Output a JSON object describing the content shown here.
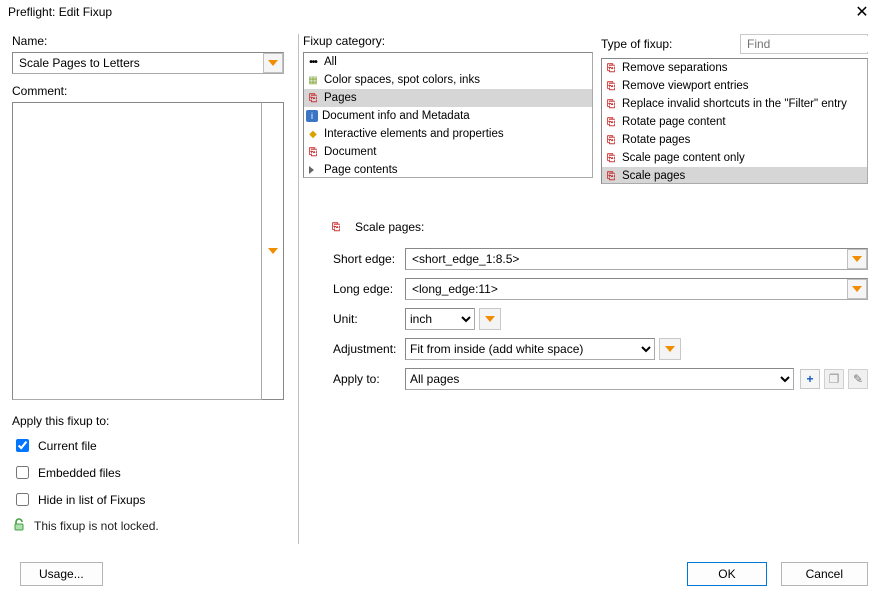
{
  "title": "Preflight: Edit Fixup",
  "left": {
    "name_label": "Name:",
    "name_value": "Scale Pages to Letters",
    "comment_label": "Comment:",
    "apply_label": "Apply this fixup to:",
    "current_file": "Current file",
    "embedded_files": "Embedded files",
    "hide_in_list": "Hide in list of Fixups",
    "lock_text": "This fixup is not locked.",
    "usage_btn": "Usage..."
  },
  "cat": {
    "label": "Fixup category:",
    "items": [
      "All",
      "Color spaces, spot colors, inks",
      "Pages",
      "Document info and Metadata",
      "Interactive elements and properties",
      "Document",
      "Page contents"
    ]
  },
  "typ": {
    "label": "Type of fixup:",
    "find_placeholder": "Find",
    "items": [
      "Remove separations",
      "Remove viewport entries",
      "Replace invalid shortcuts in the \"Filter\" entry",
      "Rotate page content",
      "Rotate pages",
      "Scale page content only",
      "Scale pages"
    ]
  },
  "detail": {
    "header": "Scale pages:",
    "short_label": "Short edge:",
    "short_value": "<short_edge_1:8.5>",
    "long_label": "Long edge:",
    "long_value": "<long_edge:11>",
    "unit_label": "Unit:",
    "unit_value": "inch",
    "adj_label": "Adjustment:",
    "adj_value": "Fit from inside (add white space)",
    "apply_label": "Apply to:",
    "apply_value": "All pages"
  },
  "footer": {
    "ok": "OK",
    "cancel": "Cancel"
  }
}
